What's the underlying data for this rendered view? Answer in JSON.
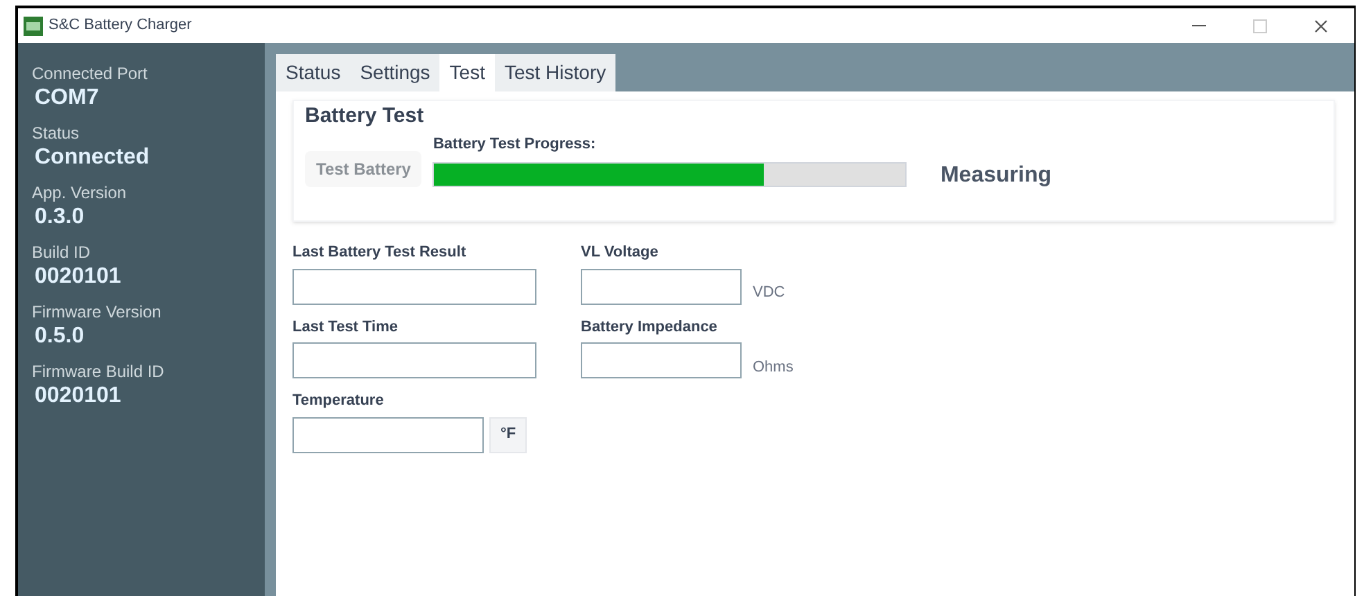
{
  "window": {
    "title": "S&C Battery Charger"
  },
  "sidebar": {
    "items": [
      {
        "label": "Connected Port",
        "value": "COM7"
      },
      {
        "label": "Status",
        "value": "Connected"
      },
      {
        "label": "App. Version",
        "value": "0.3.0"
      },
      {
        "label": "Build ID",
        "value": "0020101"
      },
      {
        "label": "Firmware Version",
        "value": "0.5.0"
      },
      {
        "label": "Firmware Build ID",
        "value": "0020101"
      }
    ]
  },
  "tabs": [
    {
      "label": "Status",
      "selected": false
    },
    {
      "label": "Settings",
      "selected": false
    },
    {
      "label": "Test",
      "selected": true
    },
    {
      "label": "Test History",
      "selected": false
    }
  ],
  "battery_test": {
    "title": "Battery Test",
    "button": {
      "label": "Test Battery",
      "disabled": true
    },
    "progress_label": "Battery Test Progress:",
    "level": 0.7,
    "status": "Measuring"
  },
  "fields": [
    {
      "label": "Last Battery Test Result"
    },
    {
      "label": "VL Voltage",
      "unit": "VDC"
    },
    {
      "label": "Last Test Time"
    },
    {
      "label": "Battery Impedance",
      "unit": "Ohms"
    }
  ],
  "temperature": {
    "label": "Temperature",
    "unit_button": "°F"
  }
}
